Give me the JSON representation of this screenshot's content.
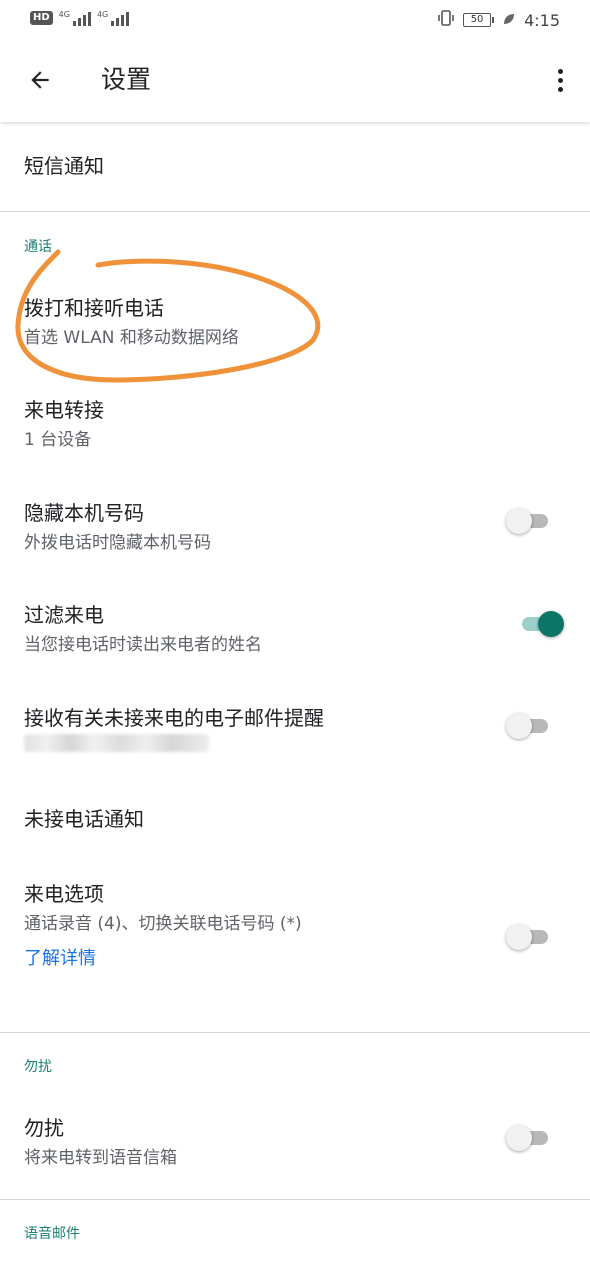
{
  "status_bar": {
    "hd_label": "HD",
    "sim1_label": "4G",
    "sim2_label": "4G",
    "battery_level": "50",
    "time": "4:15"
  },
  "app_bar": {
    "title": "设置",
    "back_icon": "arrow-back-icon",
    "more_icon": "more-vert-icon"
  },
  "top_items": [
    {
      "title": "短信通知"
    }
  ],
  "sections": {
    "calls": {
      "header": "通话",
      "items": [
        {
          "title": "拨打和接听电话",
          "subtitle": "首选 WLAN 和移动数据网络"
        },
        {
          "title": "来电转接",
          "subtitle": "1 台设备"
        },
        {
          "title": "隐藏本机号码",
          "subtitle": "外拨电话时隐藏本机号码",
          "toggle_on": false
        },
        {
          "title": "过滤来电",
          "subtitle": "当您接电话时读出来电者的姓名",
          "toggle_on": true
        },
        {
          "title": "接收有关未接来电的电子邮件提醒",
          "toggle_on": false
        },
        {
          "title": "未接电话通知"
        },
        {
          "title": "来电选项",
          "subtitle": "通话录音 (4)、切换关联电话号码 (*)",
          "link": "了解详情",
          "toggle_on": false
        }
      ]
    },
    "dnd": {
      "header": "勿扰",
      "items": [
        {
          "title": "勿扰",
          "subtitle": "将来电转到语音信箱",
          "toggle_on": false
        }
      ]
    },
    "voicemail": {
      "header": "语音邮件"
    }
  },
  "colors": {
    "accent": "#0b7668",
    "section_header": "#1a7f72",
    "link": "#1a73e8",
    "annotation": "#f0923a"
  }
}
